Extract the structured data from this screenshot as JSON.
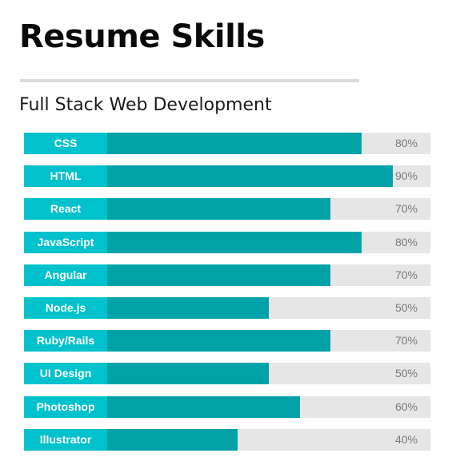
{
  "page": {
    "title": "Resume Skills",
    "subtitle": "Full Stack Web Development"
  },
  "colors": {
    "label_bg": "#00c2cc",
    "bar_fill": "#00a2a8",
    "track": "#e6e6e6",
    "divider": "#dcdcdc",
    "percent_text": "#7a7a7a"
  },
  "chart_data": {
    "type": "bar",
    "orientation": "horizontal",
    "title": "Resume Skills",
    "subtitle": "Full Stack Web Development",
    "categories": [
      "CSS",
      "HTML",
      "React",
      "JavaScript",
      "Angular",
      "Node.js",
      "Ruby/Rails",
      "UI Design",
      "Photoshop",
      "Illustrator"
    ],
    "values": [
      80,
      90,
      70,
      80,
      70,
      50,
      70,
      50,
      60,
      40
    ],
    "value_labels": [
      "80%",
      "90%",
      "70%",
      "80%",
      "70%",
      "50%",
      "70%",
      "50%",
      "60%",
      "40%"
    ],
    "xlim": [
      0,
      100
    ],
    "grid": false,
    "legend": "none"
  }
}
